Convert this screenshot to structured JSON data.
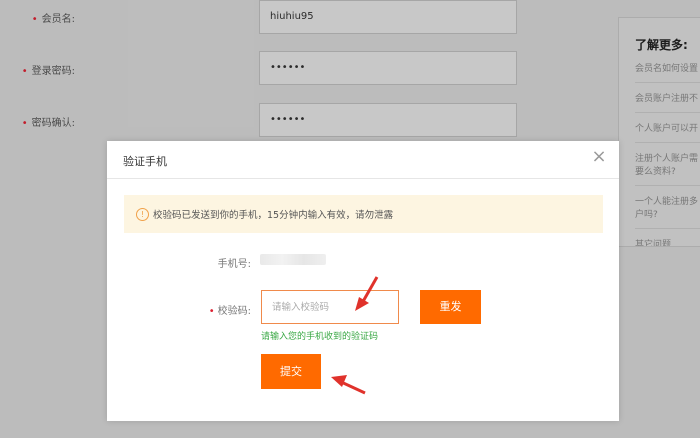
{
  "background_form": {
    "member_name_label": "会员名:",
    "member_name_value": "hiuhiu95",
    "password_label": "登录密码:",
    "password_value": "••••••",
    "confirm_label": "密码确认:",
    "confirm_value": "••••••"
  },
  "side_panel": {
    "title": "了解更多:",
    "items": [
      "会员名如何设置",
      "会员账户注册不",
      "个人账户可以开",
      "注册个人账户需要么资料?",
      "一个人能注册多户吗?",
      "其它问题"
    ]
  },
  "modal": {
    "title": "验证手机",
    "close_glyph": "×",
    "notice": "校验码已发送到你的手机，15分钟内输入有效，请勿泄露",
    "phone_label": "手机号:",
    "code_label": "校验码:",
    "code_placeholder": "请输入校验码",
    "code_value": "",
    "resend_label": "重发",
    "hint": "请输入您的手机收到的验证码",
    "submit_label": "提交"
  },
  "colors": {
    "accent": "#ff6a00",
    "hint_green": "#3aa845",
    "required_star": "#dd2233",
    "annotation_arrow": "#e0322b"
  }
}
